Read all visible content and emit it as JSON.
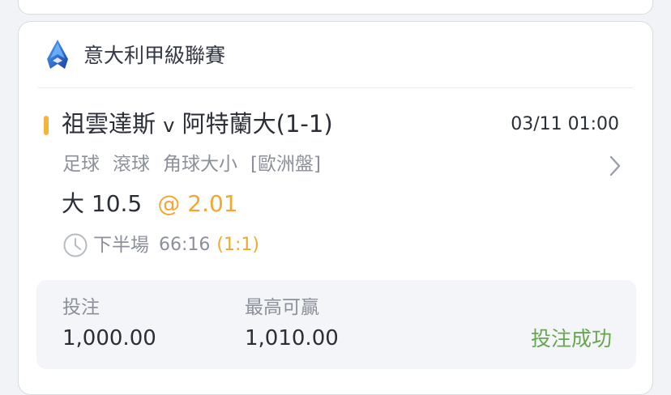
{
  "league": {
    "logo_icon": "serie-a-logo",
    "name": "意大利甲級聯賽"
  },
  "match": {
    "home_team": "祖雲達斯",
    "vs": "v",
    "away_team": "阿特蘭大",
    "score": "(1-1)",
    "datetime": "03/11 01:00"
  },
  "market": {
    "sport": "足球",
    "type": "滾球",
    "bet_type": "角球大小",
    "odds_format": "[歐洲盤]"
  },
  "selection": {
    "pick": "大 10.5",
    "odds": "@ 2.01"
  },
  "live": {
    "period": "下半場",
    "clock": "66:16",
    "score": "(1:1)"
  },
  "bet": {
    "stake_label": "投注",
    "stake_value": "1,000.00",
    "max_win_label": "最高可贏",
    "max_win_value": "1,010.00",
    "status": "投注成功"
  },
  "colors": {
    "accent": "#f4b43c",
    "odds": "#f0a832",
    "success": "#67a84f",
    "logo": "#2c66d6"
  }
}
